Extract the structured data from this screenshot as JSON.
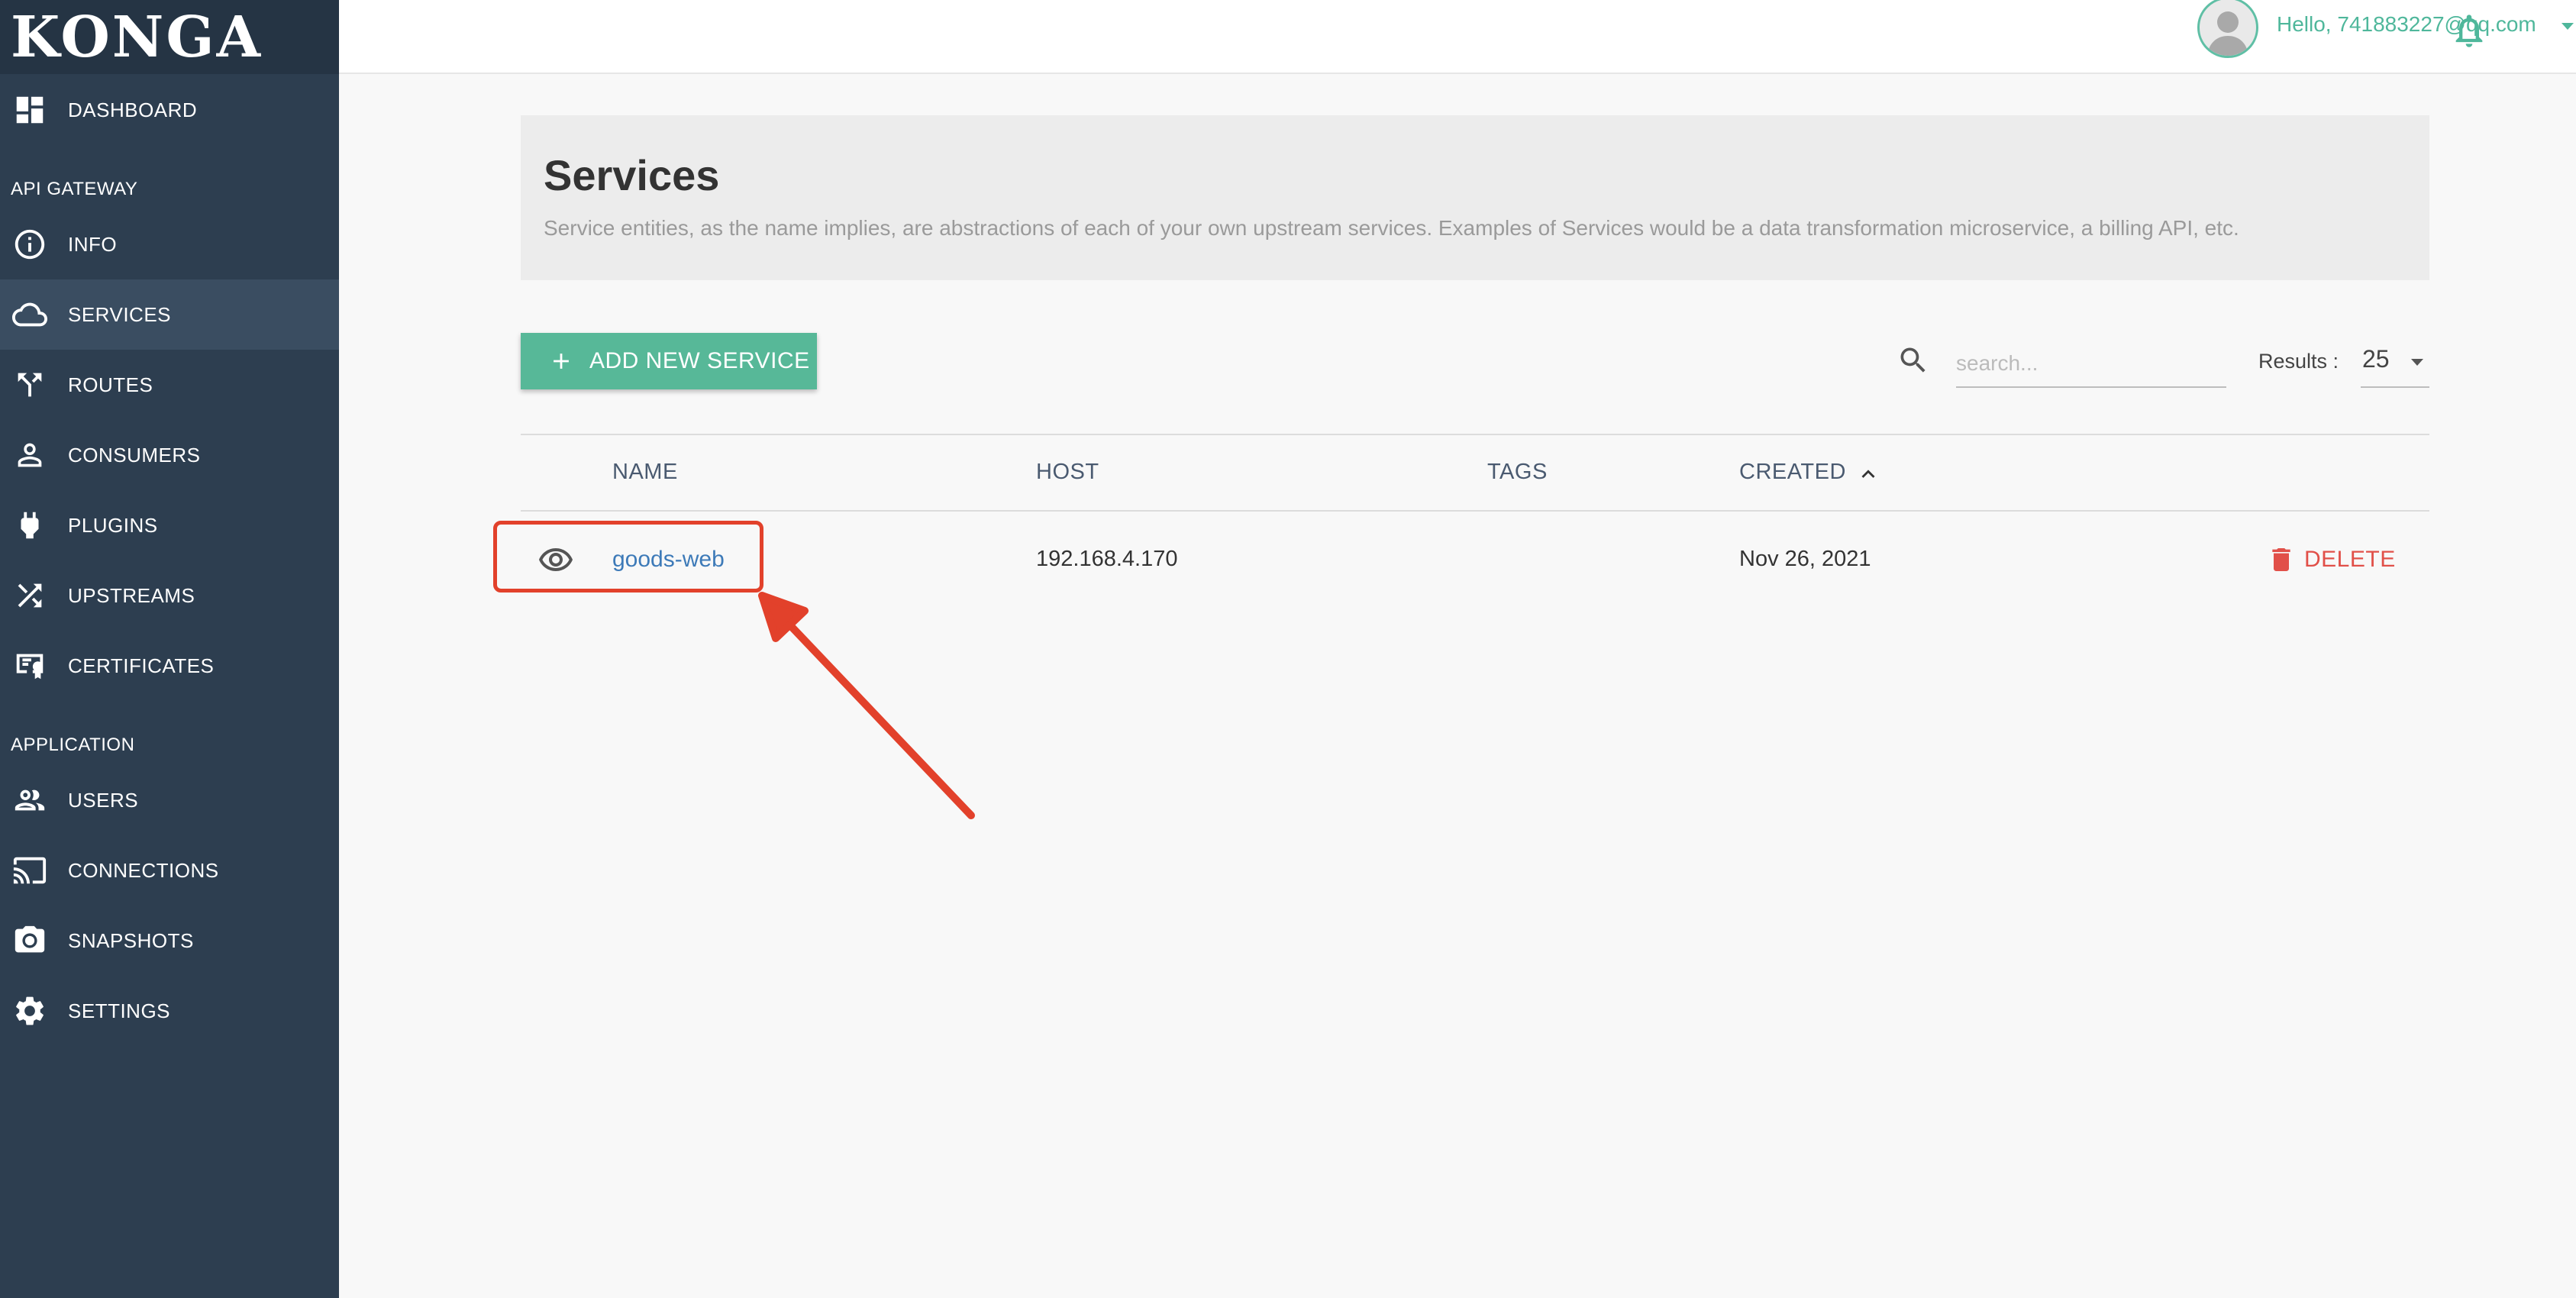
{
  "app": {
    "logo": "KONGA"
  },
  "sidebar": {
    "dashboard": "DASHBOARD",
    "section_api": "API GATEWAY",
    "info": "INFO",
    "services": "SERVICES",
    "routes": "ROUTES",
    "consumers": "CONSUMERS",
    "plugins": "PLUGINS",
    "upstreams": "UPSTREAMS",
    "certificates": "CERTIFICATES",
    "section_app": "APPLICATION",
    "users": "USERS",
    "connections": "CONNECTIONS",
    "snapshots": "SNAPSHOTS",
    "settings": "SETTINGS"
  },
  "topbar": {
    "greeting": "Hello, 741883227@qq.com"
  },
  "header": {
    "title": "Services",
    "description": "Service entities, as the name implies, are abstractions of each of your own upstream services. Examples of Services would be a data transformation microservice, a billing API, etc."
  },
  "toolbar": {
    "add_label": "ADD NEW SERVICE",
    "search_placeholder": "search...",
    "results_label": "Results :",
    "results_value": "25"
  },
  "table": {
    "columns": [
      "NAME",
      "HOST",
      "TAGS",
      "CREATED"
    ],
    "rows": [
      {
        "name": "goods-web",
        "host": "192.168.4.170",
        "tags": "",
        "created": "Nov 26, 2021",
        "action": "DELETE"
      }
    ]
  },
  "colors": {
    "sidebar": "#2d3e50",
    "accent": "#57b898",
    "danger": "#e15049",
    "link": "#3d7ab8",
    "annotation": "#e2412b"
  }
}
